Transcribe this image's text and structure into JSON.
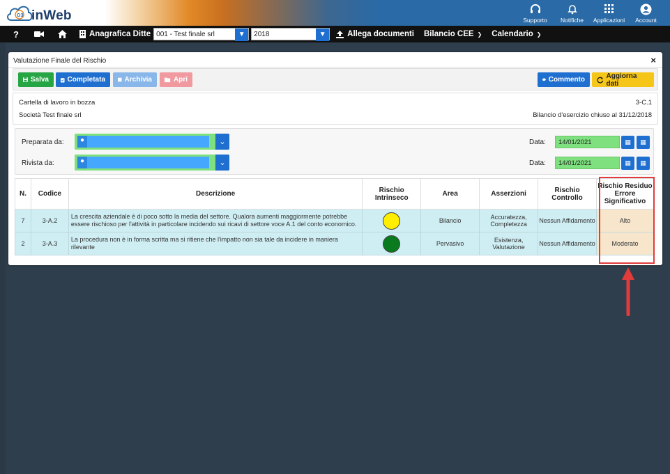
{
  "app": {
    "logo_text": "inWeb",
    "logo_badge": "G3"
  },
  "header": {
    "icons": [
      {
        "name": "headset-icon",
        "label": "Supporto"
      },
      {
        "name": "bell-icon",
        "label": "Notifiche"
      },
      {
        "name": "grid-icon",
        "label": "Applicazioni"
      },
      {
        "name": "account-icon",
        "label": "Account"
      }
    ]
  },
  "navbar": {
    "help": "?",
    "anagrafica": "Anagrafica Ditte",
    "company_select": "001 - Test finale srl",
    "year_select": "2018",
    "allega": "Allega documenti",
    "bilancio": "Bilancio CEE",
    "calendario": "Calendario"
  },
  "modal": {
    "title": "Valutazione Finale del Rischio",
    "close": "×",
    "toolbar": {
      "salva": "Salva",
      "completata": "Completata",
      "archivia": "Archivia",
      "apri": "Apri",
      "commento": "Commento",
      "aggiorna": "Aggiorna dati"
    },
    "info": {
      "stato": "Cartella di lavoro in bozza",
      "codice": "3-C.1",
      "societa": "Società Test finale srl",
      "bilancio": "Bilancio d'esercizio chiuso al 31/12/2018"
    },
    "prep": {
      "preparata_label": "Preparata da:",
      "rivista_label": "Rivista da:",
      "data_label": "Data:",
      "data1": "14/01/2021",
      "data2": "14/01/2021"
    },
    "table": {
      "headers": {
        "n": "N.",
        "codice": "Codice",
        "descrizione": "Descrizione",
        "rischio_intrinseco": "Rischio Intrinseco",
        "area": "Area",
        "asserzioni": "Asserzioni",
        "rischio_controllo": "Rischio Controllo",
        "rischio_residuo": "Rischio Residuo Errore Significativo"
      },
      "rows": [
        {
          "n": "7",
          "codice": "3-A.2",
          "descrizione": "La crescita aziendale è di poco sotto la media del settore. Qualora aumenti maggiormente potrebbe essere rischioso per l'attività in particolare incidendo sui ricavi di settore voce A.1 del conto economico.",
          "dot_color": "#ffee00",
          "area": "Bilancio",
          "asserzioni": "Accuratezza, Completezza",
          "rischio_controllo": "Nessun Affidamento",
          "rischio_residuo": "Alto"
        },
        {
          "n": "2",
          "codice": "3-A.3",
          "descrizione": "La procedura non è in forma scritta ma si ritiene che l'impatto non sia tale da incidere in maniera rilevante",
          "dot_color": "#0a7a1e",
          "area": "Pervasivo",
          "asserzioni": "Esistenza, Valutazione",
          "rischio_controllo": "Nessun Affidamento",
          "rischio_residuo": "Moderato"
        }
      ]
    }
  },
  "colors": {
    "primary": "#1f6fd1",
    "success": "#25a544",
    "warning": "#f5c518",
    "annotation": "#e23b3b"
  }
}
